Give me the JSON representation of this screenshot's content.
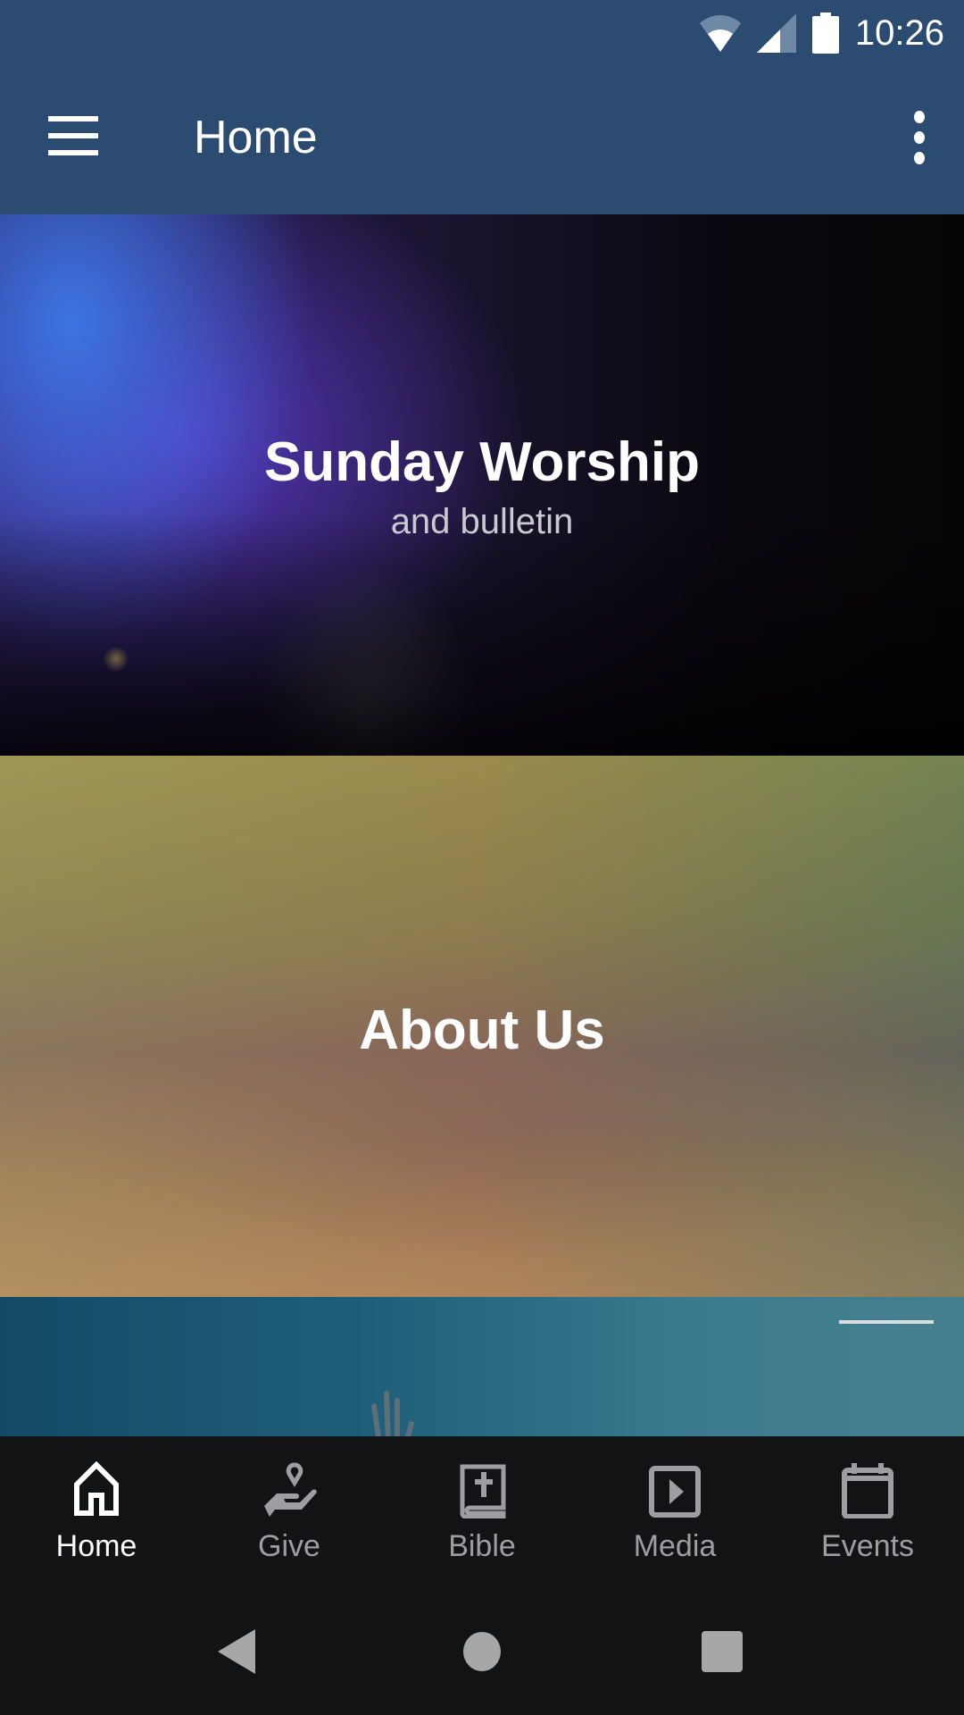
{
  "status_bar": {
    "time": "10:26",
    "icons": [
      "wifi-icon",
      "cellular-signal-icon",
      "battery-icon"
    ]
  },
  "app_bar": {
    "menu_icon": "hamburger-menu-icon",
    "title": "Home",
    "overflow_icon": "more-vert-icon"
  },
  "cards": [
    {
      "title": "Sunday Worship",
      "subtitle": "and bulletin"
    },
    {
      "title": "About Us",
      "subtitle": ""
    },
    {
      "title": "",
      "subtitle": ""
    }
  ],
  "bottom_nav": {
    "items": [
      {
        "label": "Home",
        "icon": "home-icon",
        "active": true
      },
      {
        "label": "Give",
        "icon": "give-hand-heart-icon",
        "active": false
      },
      {
        "label": "Bible",
        "icon": "bible-icon",
        "active": false
      },
      {
        "label": "Media",
        "icon": "media-play-icon",
        "active": false
      },
      {
        "label": "Events",
        "icon": "calendar-icon",
        "active": false
      }
    ]
  },
  "system_nav": {
    "buttons": [
      "back-icon",
      "home-circle-icon",
      "recents-icon"
    ]
  },
  "colors": {
    "app_bar": "#2b4c70",
    "nav_background": "#121315",
    "nav_active": "#ffffff",
    "nav_inactive": "#9d9ea2"
  }
}
